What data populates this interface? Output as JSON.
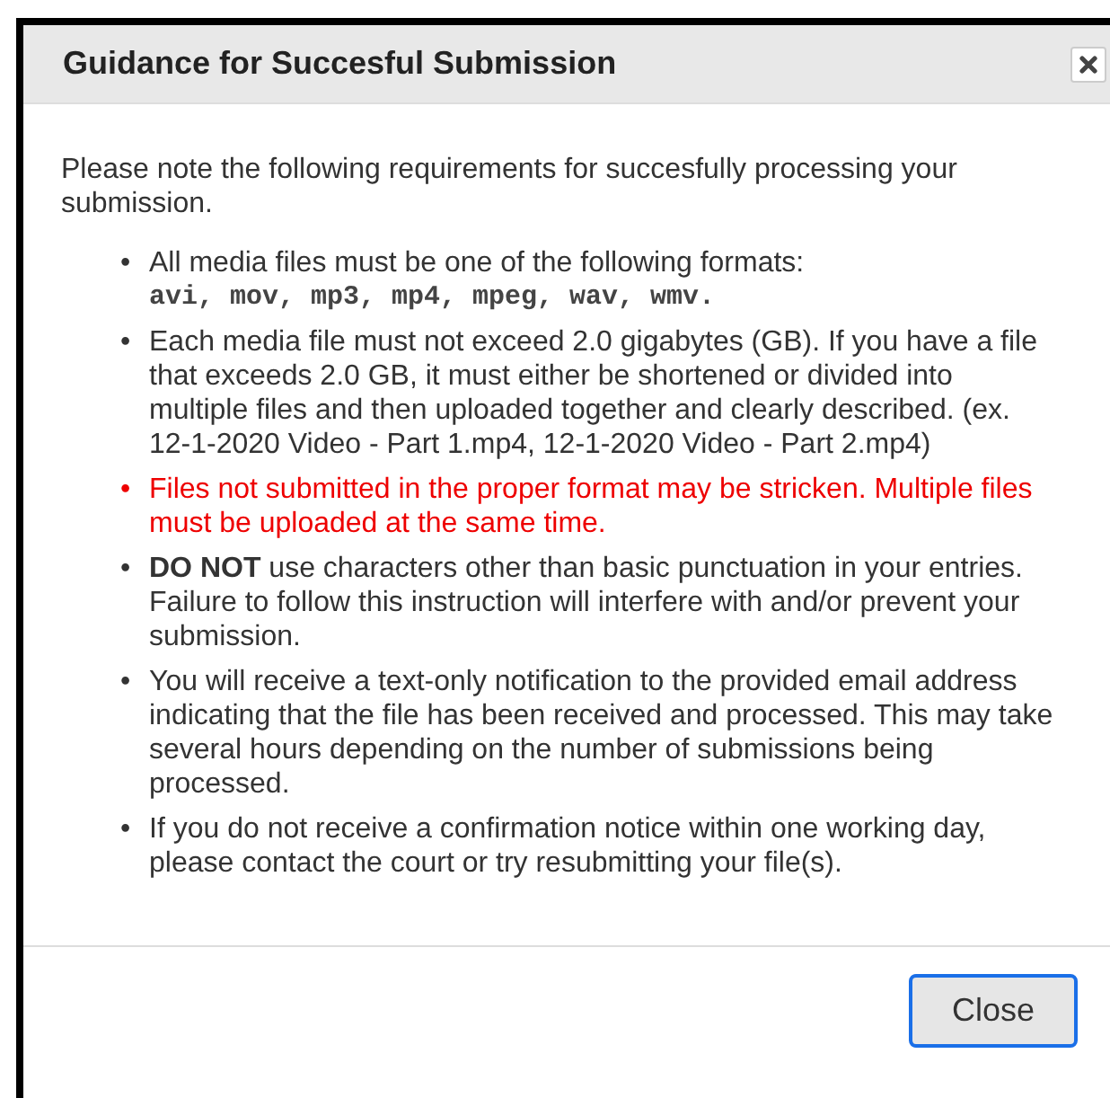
{
  "dialog": {
    "title": "Guidance for Succesful Submission",
    "intro": "Please note the following requirements for succesfully processing your submission.",
    "items": [
      {
        "kind": "plain",
        "marker": "•",
        "text": "All media files must be one of the following formats:",
        "formats": "avi, mov, mp3, mp4, mpeg, wav, wmv."
      },
      {
        "kind": "plain",
        "marker": "•",
        "text": "Each media file must not exceed 2.0 gigabytes (GB). If you have a file that exceeds 2.0 GB, it must either be shortened or divided into multiple files and then uploaded together and clearly described. (ex. 12-1-2020 Video - Part 1.mp4, 12-1-2020 Video - Part 2.mp4)"
      },
      {
        "kind": "warning",
        "marker": "•",
        "text": "Files not submitted in the proper format may be stricken. Multiple files must be uploaded at the same time."
      },
      {
        "kind": "plain",
        "marker": "•",
        "text": "**DO NOT** use characters other than basic punctuation in your entries. Failure to follow this instruction will interfere with and/or prevent your submission."
      },
      {
        "kind": "plain",
        "marker": "•",
        "text": "You will receive a text-only notification to the provided email address indicating that the file has been received and processed. This may take several hours depending on the number of submissions being processed."
      },
      {
        "kind": "plain",
        "marker": "•",
        "text": "If you do not receive a confirmation notice within one working day, please contact the court or try resubmitting your file(s)."
      }
    ],
    "button": "Close"
  }
}
